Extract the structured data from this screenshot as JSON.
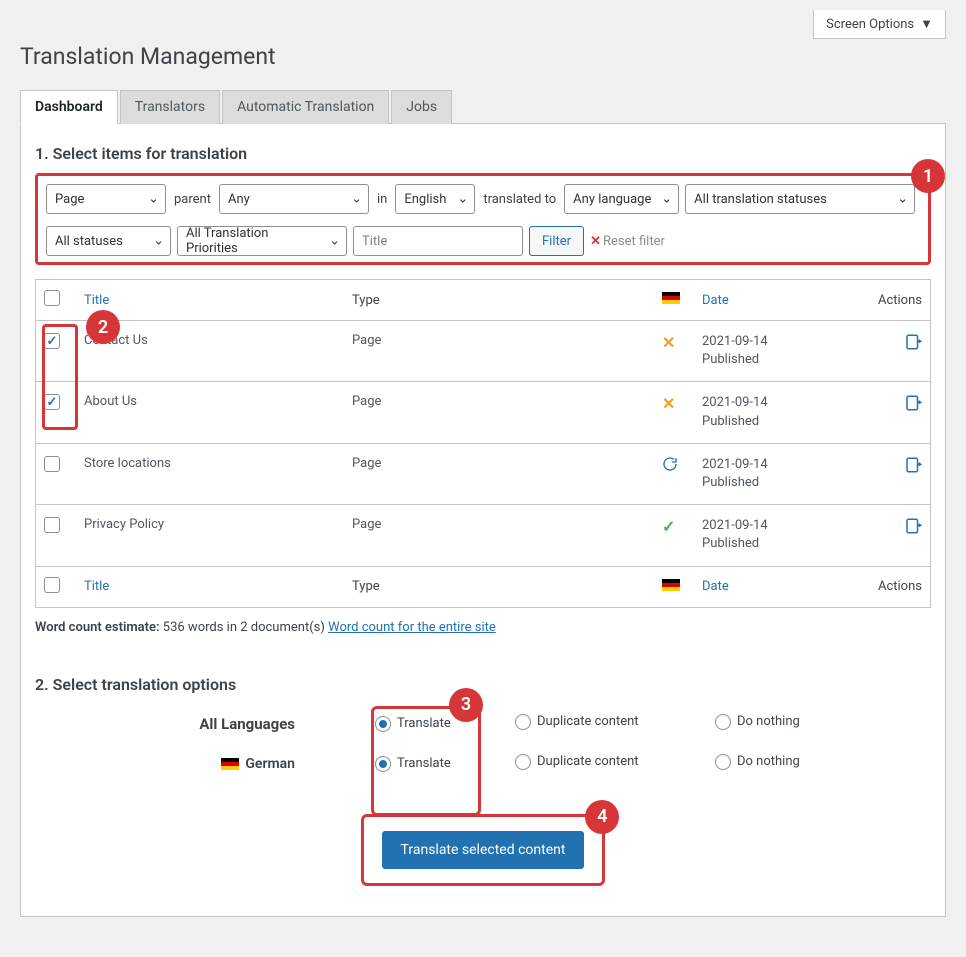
{
  "screen_options": "Screen Options",
  "page_title": "Translation Management",
  "tabs": [
    "Dashboard",
    "Translators",
    "Automatic Translation",
    "Jobs"
  ],
  "section1_title": "1. Select items for translation",
  "filters": {
    "post_type": "Page",
    "parent_label": "parent",
    "parent_value": "Any",
    "in_label": "in",
    "language": "English",
    "translated_to_label": "translated to",
    "target_language": "Any language",
    "translation_status": "All translation statuses",
    "post_status": "All statuses",
    "priority": "All Translation Priorities",
    "title_placeholder": "Title",
    "filter_btn": "Filter",
    "reset_label": "Reset filter"
  },
  "columns": {
    "title": "Title",
    "type": "Type",
    "date": "Date",
    "actions": "Actions"
  },
  "rows": [
    {
      "title": "Contact Us",
      "type": "Page",
      "status": "not-translated",
      "date": "2021-09-14",
      "state": "Published",
      "checked": true
    },
    {
      "title": "About Us",
      "type": "Page",
      "status": "not-translated",
      "date": "2021-09-14",
      "state": "Published",
      "checked": true
    },
    {
      "title": "Store locations",
      "type": "Page",
      "status": "in-progress",
      "date": "2021-09-14",
      "state": "Published",
      "checked": false
    },
    {
      "title": "Privacy Policy",
      "type": "Page",
      "status": "translated",
      "date": "2021-09-14",
      "state": "Published",
      "checked": false
    }
  ],
  "word_count": {
    "prefix": "Word count estimate:",
    "text": "536 words in 2 document(s)",
    "link": "Word count for the entire site"
  },
  "section2_title": "2. Select translation options",
  "options": {
    "all_languages": "All Languages",
    "german": "German",
    "translate": "Translate",
    "duplicate": "Duplicate content",
    "do_nothing": "Do nothing"
  },
  "submit_btn": "Translate selected content",
  "callouts": {
    "one": "1",
    "two": "2",
    "three": "3",
    "four": "4"
  }
}
